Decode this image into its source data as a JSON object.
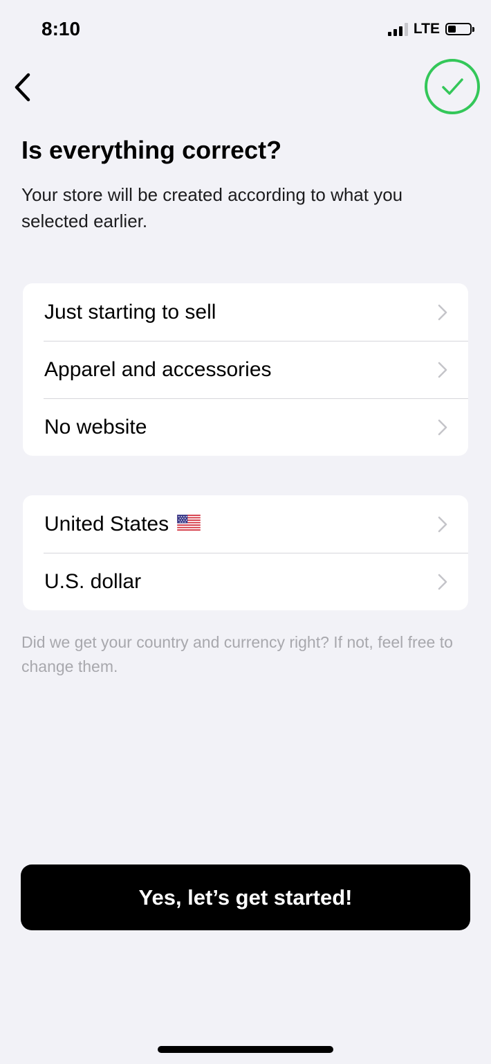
{
  "status_bar": {
    "time": "8:10",
    "network": "LTE",
    "signal_bars_active": 3,
    "battery_level": 0.35
  },
  "nav": {
    "back_icon": "chevron-left-icon",
    "confirm_icon": "checkmark-circle-icon",
    "accent_color": "#34c759"
  },
  "header": {
    "title": "Is everything correct?",
    "subtitle": "Your store will be created according to what you selected earlier."
  },
  "selections": [
    {
      "label": "Just starting to sell"
    },
    {
      "label": "Apparel and accessories"
    },
    {
      "label": "No website"
    }
  ],
  "locale": {
    "country": "United States",
    "country_flag_icon": "us-flag-icon",
    "currency": "U.S. dollar"
  },
  "helper_text": "Did we get your country and currency right? If not, feel free to change them.",
  "cta": {
    "label": "Yes, let’s get started!"
  },
  "colors": {
    "background": "#f2f2f7",
    "card": "#ffffff",
    "button": "#000000",
    "button_text": "#ffffff",
    "muted_text": "#a8a8ad"
  }
}
